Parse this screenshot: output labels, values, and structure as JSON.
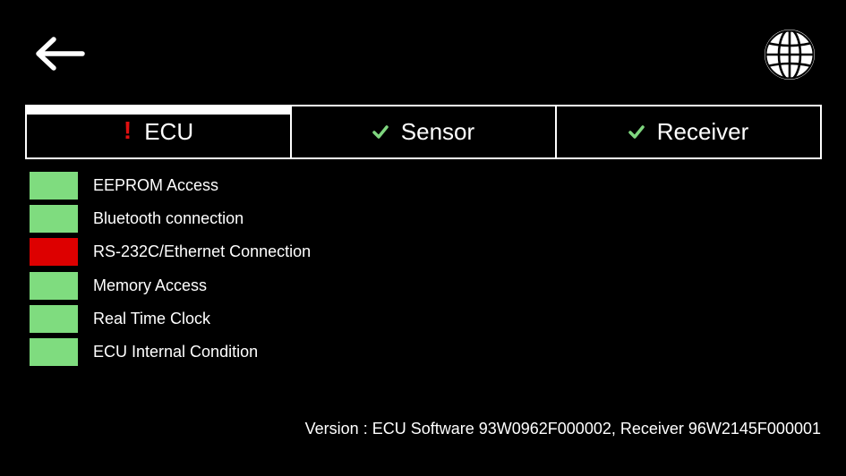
{
  "header": {
    "back_icon": "arrow-left-icon",
    "language_icon": "globe-icon"
  },
  "tabs": [
    {
      "label": "ECU",
      "status": "error",
      "status_icon": "exclamation-icon",
      "status_glyph": "!",
      "active": true
    },
    {
      "label": "Sensor",
      "status": "ok",
      "status_icon": "checkmark-icon",
      "active": false
    },
    {
      "label": "Receiver",
      "status": "ok",
      "status_icon": "checkmark-icon",
      "active": false
    }
  ],
  "status_items": [
    {
      "label": "EEPROM Access",
      "status": "ok"
    },
    {
      "label": "Bluetooth connection",
      "status": "ok"
    },
    {
      "label": "RS-232C/Ethernet Connection",
      "status": "error"
    },
    {
      "label": "Memory Access",
      "status": "ok"
    },
    {
      "label": "Real Time Clock",
      "status": "ok"
    },
    {
      "label": "ECU Internal Condition",
      "status": "ok"
    }
  ],
  "colors": {
    "background": "#000000",
    "foreground": "#ffffff",
    "ok": "#7fdc7f",
    "error": "#dd0000",
    "check": "#7fd67f",
    "exclamation": "#e01010"
  },
  "footer": {
    "version": "Version : ECU Software 93W0962F000002, Receiver 96W2145F000001"
  }
}
